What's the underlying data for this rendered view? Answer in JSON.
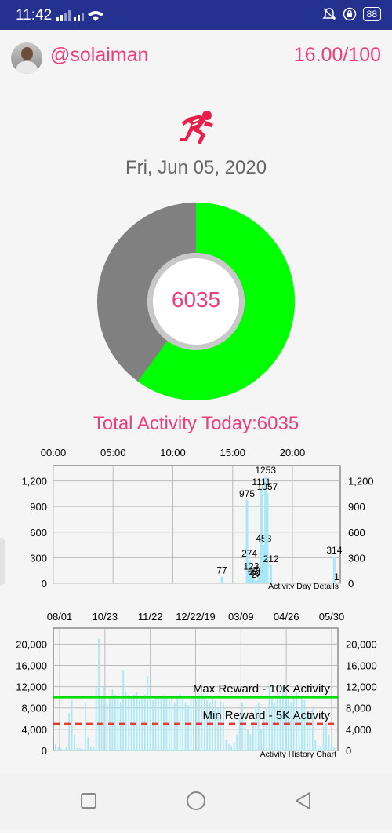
{
  "status_bar": {
    "time": "11:42",
    "battery": "88"
  },
  "header": {
    "username": "@solaiman",
    "score": "16.00/100"
  },
  "runner_icon": "runner-icon",
  "date": "Fri, Jun 05, 2020",
  "donut": {
    "value": "6035",
    "fraction_done": 0.6,
    "colors": {
      "done": "#00ff00",
      "remaining": "#808080"
    }
  },
  "total_label": "Total Activity Today:6035",
  "chart_data": [
    {
      "type": "bar",
      "legend": "Activity Day Details",
      "x_ticks": [
        "00:00",
        "05:00",
        "10:00",
        "15:00",
        "20:00"
      ],
      "x_tick_hours": [
        0,
        5,
        10,
        15,
        20
      ],
      "xlim": [
        0,
        24
      ],
      "y_ticks": [
        "0",
        "300",
        "600",
        "900",
        "1,200"
      ],
      "y_tick_values": [
        0,
        300,
        600,
        900,
        1200
      ],
      "ylim": [
        0,
        1380
      ],
      "color": "#a6e8f7",
      "bars": [
        {
          "x": 14.1,
          "y": 77,
          "label": "77"
        },
        {
          "x": 16.2,
          "y": 975,
          "label": "975"
        },
        {
          "x": 16.4,
          "y": 274,
          "label": "274"
        },
        {
          "x": 16.55,
          "y": 123,
          "label": "123"
        },
        {
          "x": 16.7,
          "y": 65,
          "label": "65"
        },
        {
          "x": 16.85,
          "y": 40,
          "label": "40"
        },
        {
          "x": 17.0,
          "y": 28,
          "label": "28"
        },
        {
          "x": 17.15,
          "y": 76,
          "label": "76"
        },
        {
          "x": 17.4,
          "y": 1111,
          "label": "1111"
        },
        {
          "x": 17.6,
          "y": 453,
          "label": "453"
        },
        {
          "x": 17.75,
          "y": 1253,
          "label": "1253"
        },
        {
          "x": 17.9,
          "y": 1057,
          "label": "1057"
        },
        {
          "x": 18.2,
          "y": 212,
          "label": "212"
        },
        {
          "x": 23.5,
          "y": 314,
          "label": "314"
        },
        {
          "x": 23.7,
          "y": 1,
          "label": "1"
        }
      ]
    },
    {
      "type": "bar",
      "legend": "Activity History Chart",
      "x_ticks": [
        "08/01",
        "10/23",
        "11/22",
        "12/22/19",
        "03/09",
        "04/26",
        "05/30"
      ],
      "y_ticks": [
        "0",
        "4,000",
        "8,000",
        "12,000",
        "16,000",
        "20,000"
      ],
      "y_tick_values": [
        0,
        4000,
        8000,
        12000,
        16000,
        20000
      ],
      "ylim": [
        0,
        23000
      ],
      "color": "#a6e8f7",
      "reference_lines": [
        {
          "value": 10000,
          "label": "Max Reward - 10K Activity",
          "color": "#00dd00",
          "style": "solid"
        },
        {
          "value": 5000,
          "label": "Min Reward - 5K Activity",
          "color": "#e53935",
          "style": "dashed"
        }
      ],
      "values": [
        1200,
        600,
        400,
        300,
        800,
        7000,
        9500,
        3000,
        500,
        400,
        300,
        9000,
        2500,
        800,
        600,
        12000,
        21000,
        10000,
        12000,
        9000,
        10000,
        11500,
        10500,
        10000,
        9000,
        15000,
        11000,
        10500,
        10000,
        10500,
        11000,
        9500,
        10000,
        10500,
        14000,
        10000,
        9500,
        10200,
        10000,
        9800,
        10400,
        10000,
        9600,
        10200,
        9000,
        10000,
        10600,
        10000,
        9000,
        8500,
        10000,
        9800,
        9500,
        10200,
        10800,
        10000,
        9500,
        9000,
        10000,
        9400,
        8000,
        9200,
        8800,
        2000,
        1200,
        900,
        1500,
        3000,
        6000,
        9000,
        7000,
        4000,
        3000,
        5500,
        8500,
        9000,
        4000,
        6000,
        8000,
        12000,
        10000,
        9000,
        11000,
        10000,
        12000,
        10500,
        10000,
        9000,
        10000,
        11000,
        8000,
        10000,
        9500,
        7000,
        5000,
        8000,
        2000,
        1000,
        800,
        4500,
        6000,
        3000,
        1500,
        600
      ]
    }
  ],
  "nav_bar": {
    "icons": [
      "recents-square-icon",
      "home-circle-icon",
      "back-triangle-icon"
    ]
  }
}
